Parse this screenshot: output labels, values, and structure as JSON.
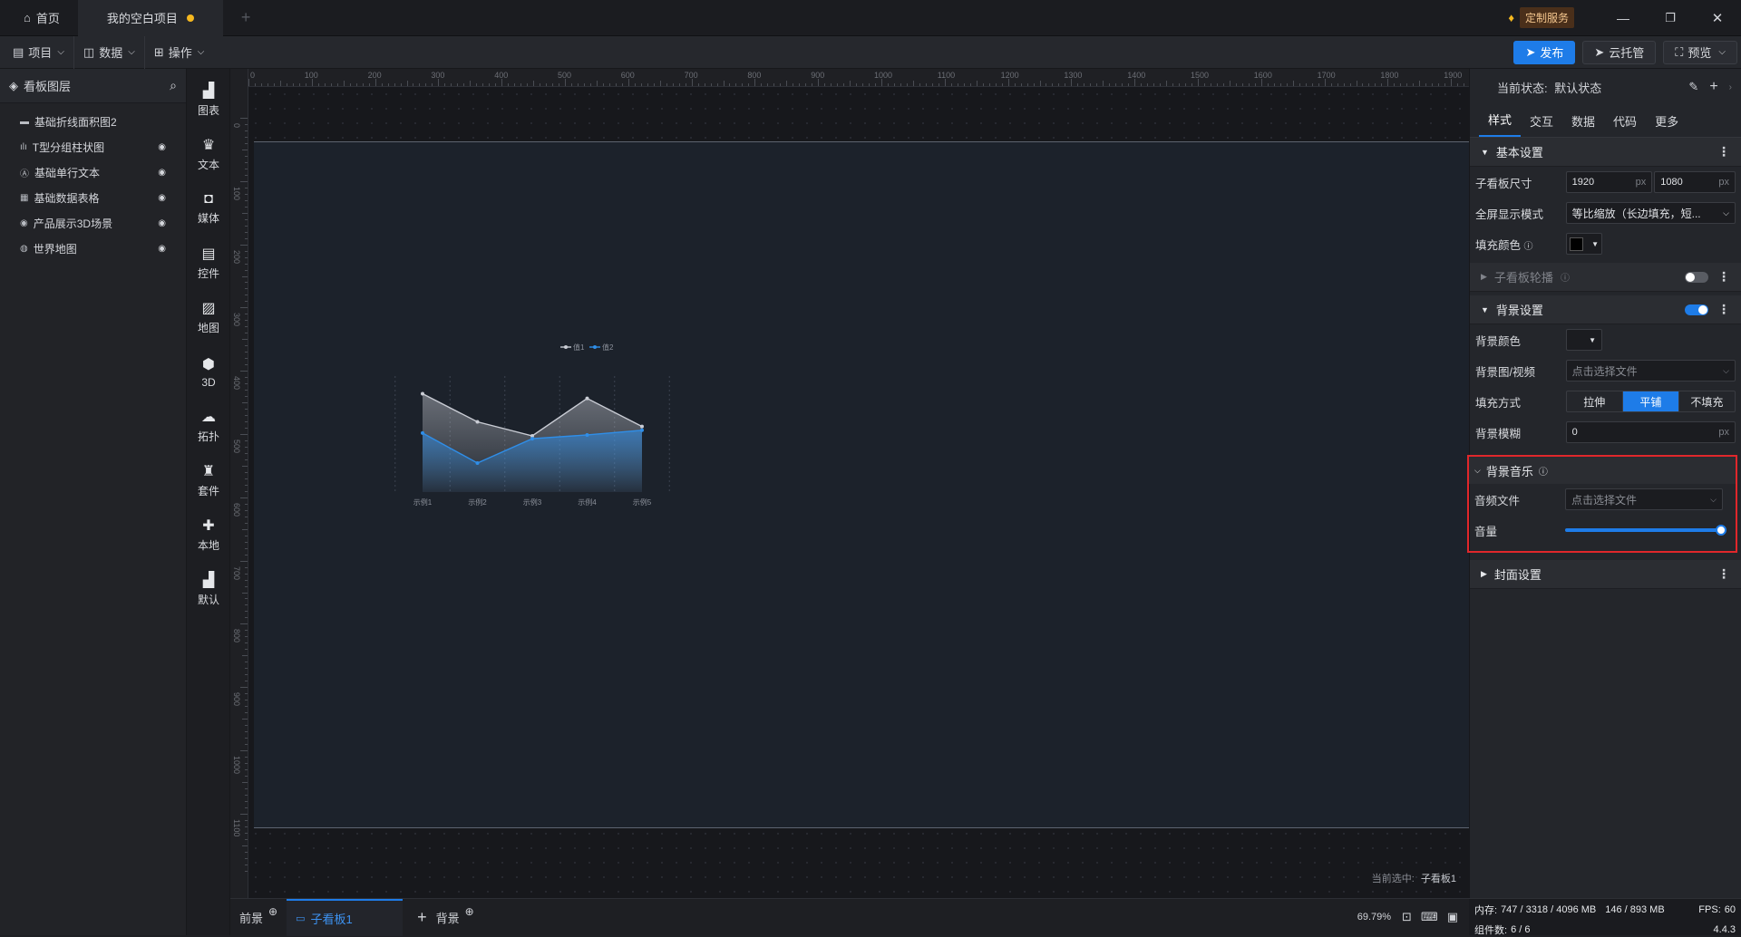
{
  "titlebar": {
    "home_tab": "首页",
    "project_tab": "我的空白项目",
    "new_tab": "+",
    "custom_service": "定制服务",
    "accent": "#f5b81f"
  },
  "menubar": {
    "menus": [
      "项目",
      "数据",
      "操作"
    ],
    "publish": "发布",
    "cloud": "云托管",
    "preview": "预览"
  },
  "layers": {
    "title": "看板图层",
    "items": [
      {
        "label": "基础折线面积图2",
        "icon": "area-chart-icon"
      },
      {
        "label": "T型分组柱状图",
        "icon": "bar-chart-icon"
      },
      {
        "label": "基础单行文本",
        "icon": "text-icon"
      },
      {
        "label": "基础数据表格",
        "icon": "table-icon"
      },
      {
        "label": "产品展示3D场景",
        "icon": "scene-3d-icon"
      },
      {
        "label": "世界地图",
        "icon": "globe-icon"
      }
    ]
  },
  "tools": [
    "图表",
    "文本",
    "媒体",
    "控件",
    "地图",
    "3D",
    "拓扑",
    "套件",
    "本地",
    "默认"
  ],
  "ruler": {
    "top": [
      "0",
      "100",
      "200",
      "300",
      "400",
      "500",
      "600",
      "700",
      "800",
      "900",
      "1000",
      "1100",
      "1200",
      "1300",
      "1400",
      "1500",
      "1600",
      "1700",
      "1800",
      "1900"
    ],
    "left": [
      "0",
      "100",
      "200",
      "300",
      "400",
      "500",
      "600",
      "700",
      "800",
      "900",
      "1000",
      "1100"
    ]
  },
  "chart_data": {
    "type": "area",
    "categories": [
      "示例1",
      "示例2",
      "示例3",
      "示例4",
      "示例5"
    ],
    "series": [
      {
        "name": "值1",
        "values": [
          105,
          75,
          60,
          100,
          70
        ],
        "color": "#c9ccd4"
      },
      {
        "name": "值2",
        "values": [
          63,
          31,
          57,
          61,
          66
        ],
        "color": "#2f8ee8"
      }
    ],
    "ylim": [
      0,
      120
    ],
    "legend": "top-right"
  },
  "canvas": {
    "selection_label": "当前选中:",
    "selection_value": "子看板1"
  },
  "bottombar": {
    "front": "前景",
    "sub_board": "子看板1",
    "add": "+",
    "back": "背景",
    "zoom": "69.79%"
  },
  "props": {
    "state_label": "当前状态:",
    "state_value": "默认状态",
    "tabs": [
      "样式",
      "交互",
      "数据",
      "代码",
      "更多"
    ],
    "basic": {
      "title": "基本设置",
      "size_label": "子看板尺寸",
      "width": "1920",
      "height": "1080",
      "unit": "px",
      "fullscreen_label": "全屏显示模式",
      "fullscreen_value": "等比缩放（长边填充，短...",
      "fill_label": "填充颜色",
      "fill_color": "#000000"
    },
    "carousel": {
      "title": "子看板轮播"
    },
    "background": {
      "title": "背景设置",
      "color_label": "背景颜色",
      "image_label": "背景图/视频",
      "image_placeholder": "点击选择文件",
      "fill_mode_label": "填充方式",
      "fill_modes": [
        "拉伸",
        "平铺",
        "不填充"
      ],
      "fill_mode_selected": "平铺",
      "blur_label": "背景模糊",
      "blur_value": "0",
      "unit": "px"
    },
    "music": {
      "title": "背景音乐",
      "file_label": "音频文件",
      "file_placeholder": "点击选择文件",
      "volume_label": "音量",
      "volume": 1.0,
      "highlight": "#e0272b"
    },
    "cover": {
      "title": "封面设置"
    }
  },
  "status": {
    "memory_label": "内存:",
    "memory": "747 / 3318 / 4096 MB",
    "memory2": "146 / 893 MB",
    "fps_label": "FPS:",
    "fps": "60",
    "components_label": "组件数:",
    "components": "6 / 6",
    "version": "4.4.3"
  }
}
